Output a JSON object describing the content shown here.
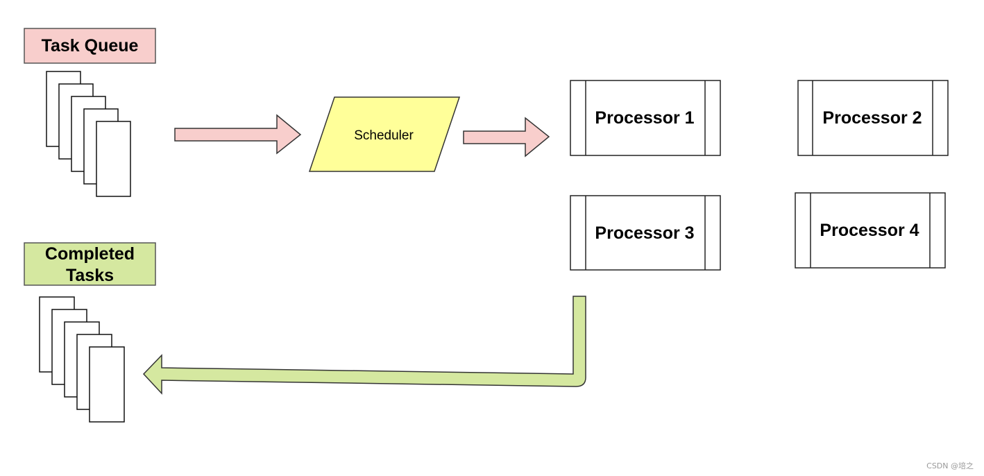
{
  "diagram": {
    "task_queue": {
      "label": "Task Queue",
      "fill": "#f8cecc",
      "stack_count": 5
    },
    "completed_tasks": {
      "label_line1": "Completed",
      "label_line2": "Tasks",
      "fill": "#d5e8a0",
      "stack_count": 5
    },
    "scheduler": {
      "label": "Scheduler",
      "fill": "#ffff99"
    },
    "processors": [
      {
        "label": "Processor 1"
      },
      {
        "label": "Processor 2"
      },
      {
        "label": "Processor 3"
      },
      {
        "label": "Processor 4"
      }
    ],
    "arrows": {
      "queue_to_scheduler": {
        "fill": "#f8cecc"
      },
      "scheduler_to_processor": {
        "fill": "#f8cecc"
      },
      "processor_to_completed": {
        "fill": "#d5e8a0"
      }
    },
    "stroke_color": "#333333"
  },
  "watermark": "CSDN @培之"
}
